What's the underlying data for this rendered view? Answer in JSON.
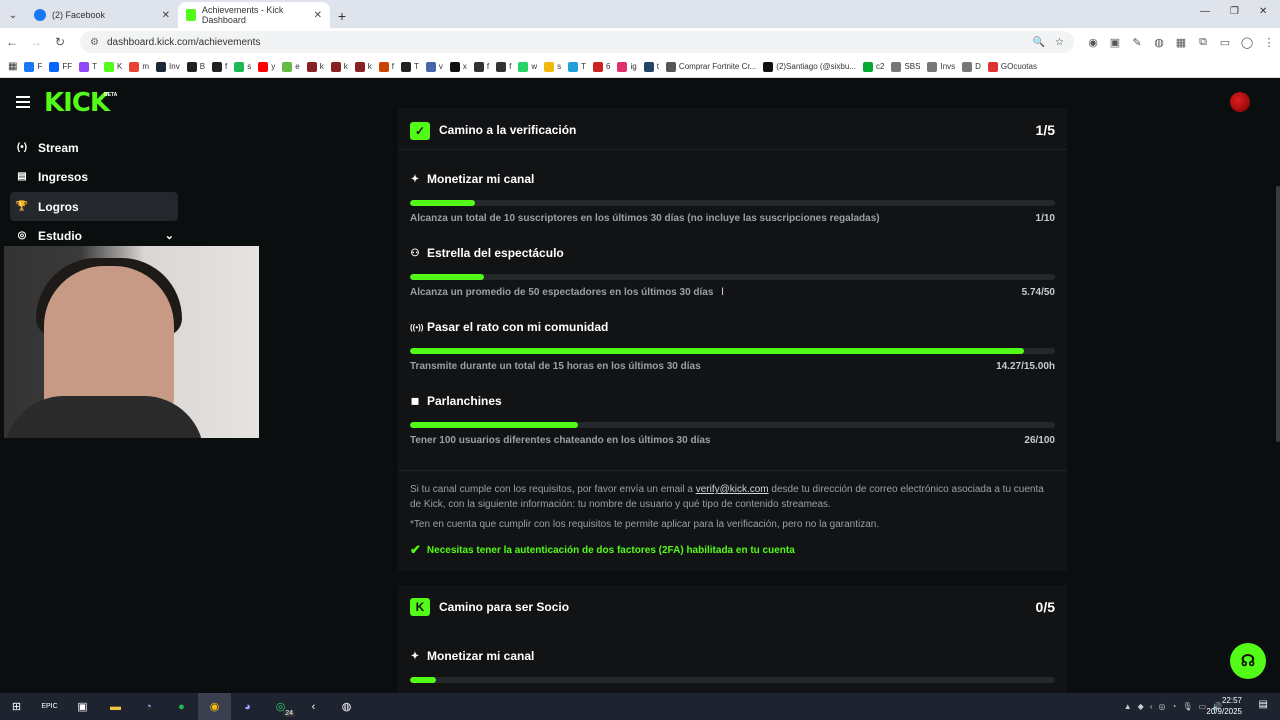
{
  "browser": {
    "tabs": [
      {
        "title": "(2) Facebook",
        "icon_color": "#1877f2",
        "active": false
      },
      {
        "title": "Achievements - Kick Dashboard",
        "icon_color": "#53fc18",
        "active": true
      }
    ],
    "url": "dashboard.kick.com/achievements",
    "bookmarks": [
      {
        "label": "F",
        "color": "#1877f2"
      },
      {
        "label": "FF",
        "color": "#0866ff"
      },
      {
        "label": "T",
        "color": "#9146ff"
      },
      {
        "label": "K",
        "color": "#53fc18"
      },
      {
        "label": "m",
        "color": "#ea4335"
      },
      {
        "label": "Inv",
        "color": "#1b2838"
      },
      {
        "label": "B",
        "color": "#222"
      },
      {
        "label": "f",
        "color": "#222"
      },
      {
        "label": "s",
        "color": "#1db954"
      },
      {
        "label": "y",
        "color": "#ff0000"
      },
      {
        "label": "e",
        "color": "#6b4"
      },
      {
        "label": "k",
        "color": "#822"
      },
      {
        "label": "k",
        "color": "#822"
      },
      {
        "label": "k",
        "color": "#822"
      },
      {
        "label": "f",
        "color": "#c40"
      },
      {
        "label": "T",
        "color": "#222"
      },
      {
        "label": "v",
        "color": "#46a"
      },
      {
        "label": "x",
        "color": "#111"
      },
      {
        "label": "f",
        "color": "#333"
      },
      {
        "label": "f",
        "color": "#333"
      },
      {
        "label": "w",
        "color": "#25d366"
      },
      {
        "label": "s",
        "color": "#f0b90b"
      },
      {
        "label": "T",
        "color": "#229ed9"
      },
      {
        "label": "6",
        "color": "#c22"
      },
      {
        "label": "ig",
        "color": "#e1306c"
      },
      {
        "label": "t",
        "color": "#246"
      },
      {
        "label": "Comprar Fortnite Cr...",
        "color": "#555"
      },
      {
        "label": "(2)Santiago (@sixbu...",
        "color": "#111"
      },
      {
        "label": "c2",
        "color": "#0a3"
      },
      {
        "label": "SBS",
        "color": "#777"
      },
      {
        "label": "Invs",
        "color": "#777"
      },
      {
        "label": "D",
        "color": "#777"
      },
      {
        "label": "GOcuotas",
        "color": "#d33"
      }
    ]
  },
  "app": {
    "logo": "KICK",
    "logo_badge": "BETA"
  },
  "sidebar": {
    "items": [
      {
        "label": "Stream",
        "icon": "broadcast-icon",
        "glyph": "(•)"
      },
      {
        "label": "Ingresos",
        "icon": "chart-icon",
        "glyph": "▤"
      },
      {
        "label": "Logros",
        "icon": "trophy-icon",
        "glyph": "🏆"
      },
      {
        "label": "Estudio",
        "icon": "camera-icon",
        "glyph": "◎"
      }
    ]
  },
  "verification": {
    "title": "Camino a la verificación",
    "count": "1/5",
    "goals": [
      {
        "title": "Monetizar mi canal",
        "icon": "sparkle-icon",
        "glyph": "✦",
        "progress": 0.1,
        "desc": "Alcanza un total de 10 suscriptores en los últimos 30 días (no incluye las suscripciones regaladas)",
        "value": "1/10"
      },
      {
        "title": "Estrella del espectáculo",
        "icon": "people-icon",
        "glyph": "👥",
        "progress": 0.1148,
        "desc": "Alcanza un promedio de 50 espectadores en los últimos 30 días",
        "value": "5.74/50"
      },
      {
        "title": "Pasar el rato con mi comunidad",
        "icon": "broadcast-icon",
        "glyph": "((•))",
        "progress": 0.9513,
        "desc": "Transmite durante un total de 15 horas en los últimos 30 días",
        "value": "14.27/15.00h"
      },
      {
        "title": "Parlanchines",
        "icon": "chat-icon",
        "glyph": "💬",
        "progress": 0.26,
        "desc": "Tener 100 usuarios diferentes chateando en los últimos 30 días",
        "value": "26/100"
      }
    ],
    "info_before": "Si tu canal cumple con los requisitos, por favor envía un email a ",
    "info_email": "verify@kick.com",
    "info_after": " desde tu dirección de correo electrónico asociada a tu cuenta de Kick, con la siguiente información: tu nombre de usuario y qué tipo de contenido streameas.",
    "note": "*Ten en cuenta que cumplir con los requisitos te permite aplicar para la verificación, pero no la garantizan.",
    "requirement": "Necesitas tener la autenticación de dos factores (2FA) habilitada en tu cuenta"
  },
  "socio": {
    "title": "Camino para ser Socio",
    "count": "0/5",
    "goals": [
      {
        "title": "Monetizar mi canal",
        "icon": "sparkle-icon",
        "glyph": "✦",
        "progress": 0.04
      }
    ]
  },
  "taskbar": {
    "apps": [
      "start-icon",
      "epic-icon",
      "store-icon",
      "folder-icon",
      "steam-icon",
      "spotify-icon",
      "chrome-icon",
      "discord-icon",
      "whatsapp-icon",
      "kick-icon",
      "obs-icon"
    ],
    "whatsapp_badge": "24",
    "time": "22:57",
    "date": "20/9/2025"
  },
  "colors": {
    "accent": "#53fc18",
    "panel": "#111315",
    "bg": "#0b0e0f"
  }
}
